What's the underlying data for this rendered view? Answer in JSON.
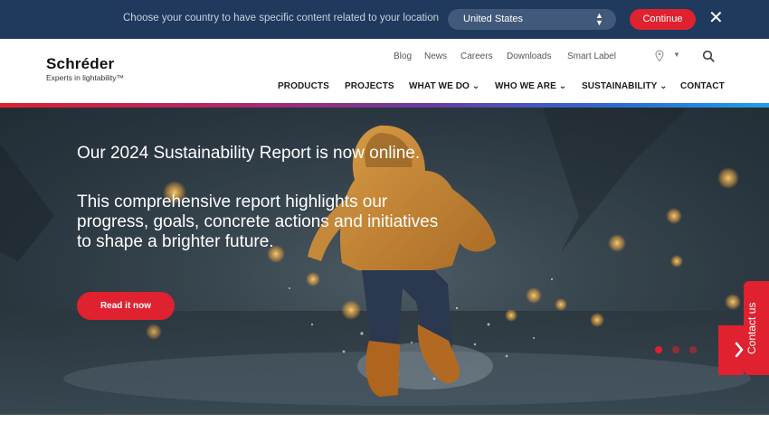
{
  "country_bar": {
    "message": "Choose your country to have specific content related to your location",
    "selected_country": "United States",
    "continue_label": "Continue",
    "close_icon": "close-icon"
  },
  "header": {
    "logo_name": "Schréder",
    "logo_tagline": "Experts in lightability™",
    "utility_links": [
      "Blog",
      "News",
      "Careers",
      "Downloads",
      "Smart Label"
    ],
    "nav": [
      "PRODUCTS",
      "PROJECTS",
      "WHAT WE DO ⌄",
      "WHO WE ARE ⌄",
      "SUSTAINABILITY ⌄",
      "CONTACT"
    ]
  },
  "hero": {
    "title": "Our 2024 Sustainability Report is now online.",
    "subtitle": "This comprehensive report highlights our progress, goals, concrete actions and initiatives to shape a brighter future.",
    "cta_label": "Read it now",
    "slide_count": 3,
    "active_slide": 1
  },
  "contact_tab": {
    "label": "Contact us"
  },
  "colors": {
    "navy": "#1f3a5c",
    "brand_red": "#e0212f",
    "raincoat": "#c98a35"
  }
}
